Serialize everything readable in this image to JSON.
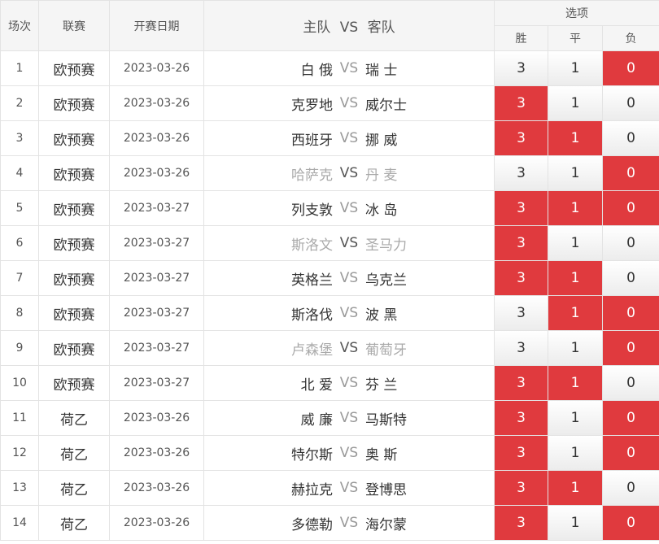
{
  "header": {
    "idx": "场次",
    "league": "联赛",
    "date": "开赛日期",
    "home": "主队",
    "vs": "VS",
    "away": "客队",
    "options": "选项",
    "win": "胜",
    "draw": "平",
    "lose": "负"
  },
  "rows": [
    {
      "idx": "1",
      "league": "欧预赛",
      "date": "2023-03-26",
      "home": "白 俄",
      "away": "瑞 士",
      "muted": false,
      "win": "3",
      "draw": "1",
      "lose": "0",
      "sel": [
        false,
        false,
        true
      ]
    },
    {
      "idx": "2",
      "league": "欧预赛",
      "date": "2023-03-26",
      "home": "克罗地",
      "away": "威尔士",
      "muted": false,
      "win": "3",
      "draw": "1",
      "lose": "0",
      "sel": [
        true,
        false,
        false
      ]
    },
    {
      "idx": "3",
      "league": "欧预赛",
      "date": "2023-03-26",
      "home": "西班牙",
      "away": "挪 威",
      "muted": false,
      "win": "3",
      "draw": "1",
      "lose": "0",
      "sel": [
        true,
        true,
        false
      ]
    },
    {
      "idx": "4",
      "league": "欧预赛",
      "date": "2023-03-26",
      "home": "哈萨克",
      "away": "丹 麦",
      "muted": true,
      "win": "3",
      "draw": "1",
      "lose": "0",
      "sel": [
        false,
        false,
        true
      ]
    },
    {
      "idx": "5",
      "league": "欧预赛",
      "date": "2023-03-27",
      "home": "列支敦",
      "away": "冰 岛",
      "muted": false,
      "win": "3",
      "draw": "1",
      "lose": "0",
      "sel": [
        true,
        true,
        true
      ]
    },
    {
      "idx": "6",
      "league": "欧预赛",
      "date": "2023-03-27",
      "home": "斯洛文",
      "away": "圣马力",
      "muted": true,
      "win": "3",
      "draw": "1",
      "lose": "0",
      "sel": [
        true,
        false,
        false
      ]
    },
    {
      "idx": "7",
      "league": "欧预赛",
      "date": "2023-03-27",
      "home": "英格兰",
      "away": "乌克兰",
      "muted": false,
      "win": "3",
      "draw": "1",
      "lose": "0",
      "sel": [
        true,
        true,
        false
      ]
    },
    {
      "idx": "8",
      "league": "欧预赛",
      "date": "2023-03-27",
      "home": "斯洛伐",
      "away": "波 黑",
      "muted": false,
      "win": "3",
      "draw": "1",
      "lose": "0",
      "sel": [
        false,
        true,
        true
      ]
    },
    {
      "idx": "9",
      "league": "欧预赛",
      "date": "2023-03-27",
      "home": "卢森堡",
      "away": "葡萄牙",
      "muted": true,
      "win": "3",
      "draw": "1",
      "lose": "0",
      "sel": [
        false,
        false,
        true
      ]
    },
    {
      "idx": "10",
      "league": "欧预赛",
      "date": "2023-03-27",
      "home": "北 爱",
      "away": "芬 兰",
      "muted": false,
      "win": "3",
      "draw": "1",
      "lose": "0",
      "sel": [
        true,
        true,
        false
      ]
    },
    {
      "idx": "11",
      "league": "荷乙",
      "date": "2023-03-26",
      "home": "威 廉",
      "away": "马斯特",
      "muted": false,
      "win": "3",
      "draw": "1",
      "lose": "0",
      "sel": [
        true,
        false,
        true
      ]
    },
    {
      "idx": "12",
      "league": "荷乙",
      "date": "2023-03-26",
      "home": "特尔斯",
      "away": "奥 斯",
      "muted": false,
      "win": "3",
      "draw": "1",
      "lose": "0",
      "sel": [
        true,
        false,
        true
      ]
    },
    {
      "idx": "13",
      "league": "荷乙",
      "date": "2023-03-26",
      "home": "赫拉克",
      "away": "登博思",
      "muted": false,
      "win": "3",
      "draw": "1",
      "lose": "0",
      "sel": [
        true,
        true,
        false
      ]
    },
    {
      "idx": "14",
      "league": "荷乙",
      "date": "2023-03-26",
      "home": "多德勒",
      "away": "海尔蒙",
      "muted": false,
      "win": "3",
      "draw": "1",
      "lose": "0",
      "sel": [
        true,
        false,
        true
      ]
    }
  ],
  "colors": {
    "selected": "#e03a3e",
    "header_bg": "#f5f5f5",
    "muted_text": "#aaaaaa"
  }
}
